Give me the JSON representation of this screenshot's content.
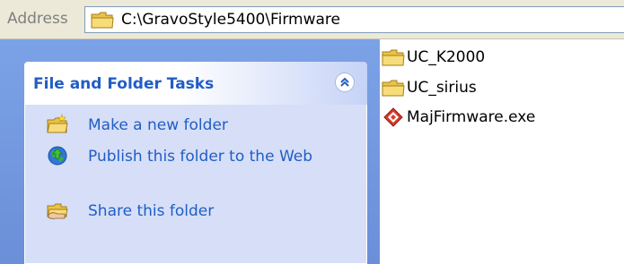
{
  "address_bar": {
    "label": "Address",
    "path": "C:\\GravoStyle5400\\Firmware"
  },
  "task_pane": {
    "title": "File and Folder Tasks",
    "items": [
      {
        "label": "Make a new folder",
        "icon": "new-folder-icon"
      },
      {
        "label": "Publish this folder to the Web",
        "icon": "globe-publish-icon"
      },
      {
        "label": "Share this folder",
        "icon": "share-folder-icon"
      }
    ],
    "collapse_icon": "chevron-up-double-icon"
  },
  "files": [
    {
      "name": "UC_K2000",
      "type": "folder"
    },
    {
      "name": "UC_sirius",
      "type": "folder"
    },
    {
      "name": "MajFirmware.exe",
      "type": "executable"
    }
  ],
  "colors": {
    "pane_blue": "#7ba2e7",
    "task_body": "#d6dff7",
    "link_blue": "#215dc6",
    "folder_yellow": "#f3d468",
    "exe_red": "#d93b2b"
  }
}
